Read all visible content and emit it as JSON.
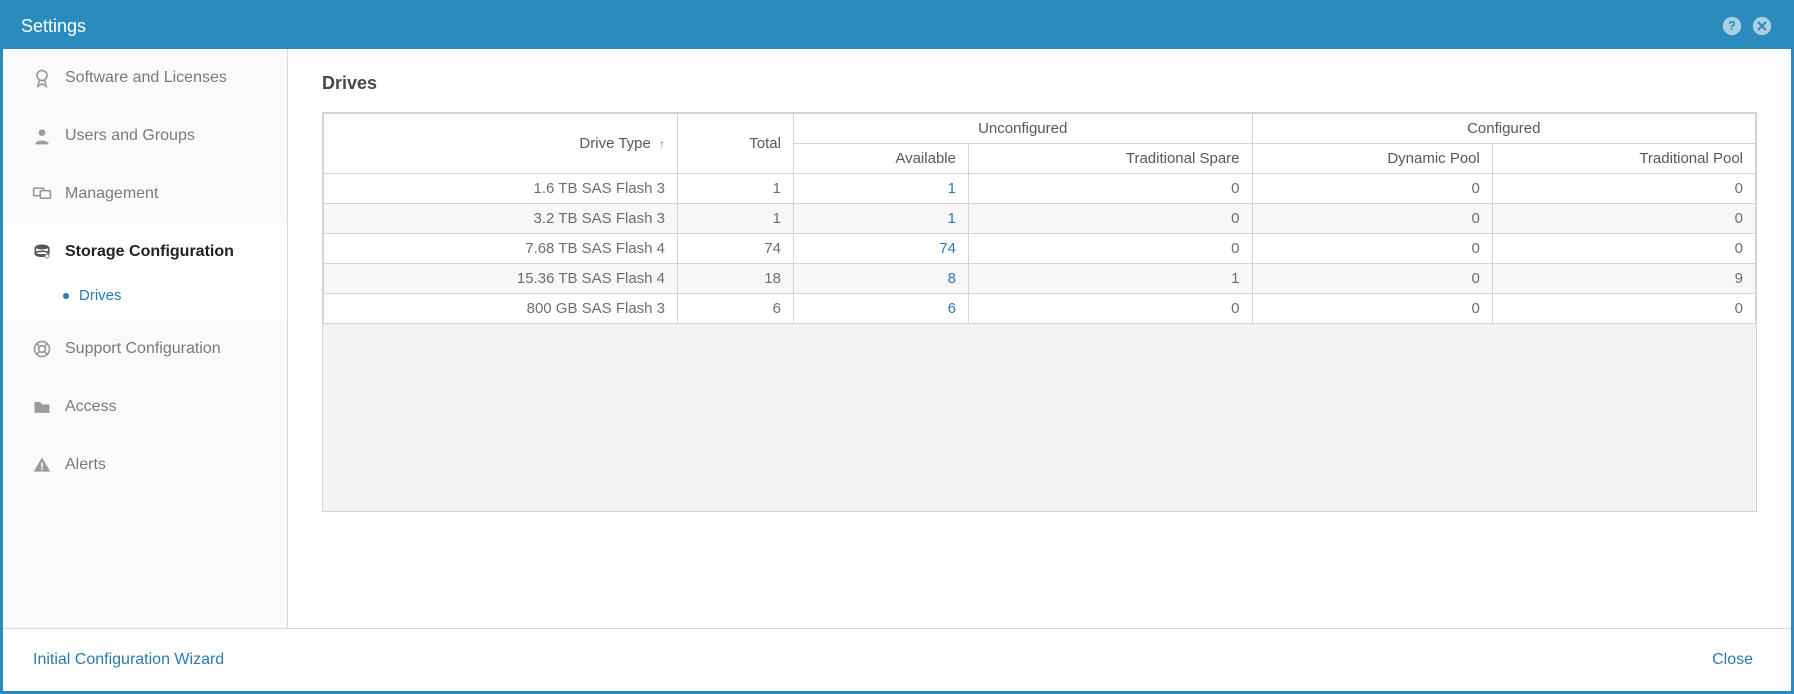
{
  "window": {
    "title": "Settings"
  },
  "sidebar": {
    "items": [
      {
        "label": "Software and Licenses"
      },
      {
        "label": "Users and Groups"
      },
      {
        "label": "Management"
      },
      {
        "label": "Storage Configuration",
        "active": true,
        "sub": {
          "label": "Drives"
        }
      },
      {
        "label": "Support Configuration"
      },
      {
        "label": "Access"
      },
      {
        "label": "Alerts"
      }
    ]
  },
  "main": {
    "title": "Drives",
    "headers": {
      "drive_type": "Drive Type",
      "total": "Total",
      "unconfigured": "Unconfigured",
      "available": "Available",
      "traditional_spare": "Traditional Spare",
      "configured": "Configured",
      "dynamic_pool": "Dynamic Pool",
      "traditional_pool": "Traditional Pool"
    },
    "rows": [
      {
        "drive_type": "1.6 TB SAS Flash 3",
        "total": "1",
        "available": "1",
        "traditional_spare": "0",
        "dynamic_pool": "0",
        "traditional_pool": "0"
      },
      {
        "drive_type": "3.2 TB SAS Flash 3",
        "total": "1",
        "available": "1",
        "traditional_spare": "0",
        "dynamic_pool": "0",
        "traditional_pool": "0"
      },
      {
        "drive_type": "7.68 TB SAS Flash 4",
        "total": "74",
        "available": "74",
        "traditional_spare": "0",
        "dynamic_pool": "0",
        "traditional_pool": "0"
      },
      {
        "drive_type": "15.36 TB SAS Flash 4",
        "total": "18",
        "available": "8",
        "traditional_spare": "1",
        "dynamic_pool": "0",
        "traditional_pool": "9"
      },
      {
        "drive_type": "800 GB SAS Flash 3",
        "total": "6",
        "available": "6",
        "traditional_spare": "0",
        "dynamic_pool": "0",
        "traditional_pool": "0"
      }
    ]
  },
  "footer": {
    "wizard_label": "Initial Configuration Wizard",
    "close_label": "Close"
  }
}
